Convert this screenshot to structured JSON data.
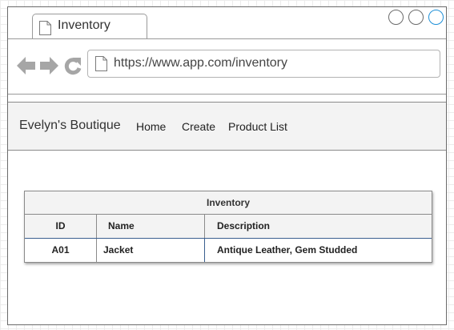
{
  "browser": {
    "tab": {
      "title": "Inventory",
      "icon": "page-icon"
    },
    "window_controls": [
      "minimize",
      "maximize",
      "close"
    ],
    "url": "https://www.app.com/inventory",
    "nav_icons": [
      "back-arrow-icon",
      "forward-arrow-icon",
      "refresh-icon"
    ]
  },
  "site": {
    "brand": "Evelyn's Boutique",
    "nav": [
      "Home",
      "Create",
      "Product List"
    ]
  },
  "table": {
    "title": "Inventory",
    "columns": [
      "ID",
      "Name",
      "Description"
    ],
    "rows": [
      [
        "A01",
        "Jacket",
        "Antique Leather, Gem Studded"
      ]
    ]
  },
  "colors": {
    "close_button_border": "#1e90d8",
    "header_background": "#f3f3f3",
    "selected_column_border": "#3a5f8f"
  }
}
